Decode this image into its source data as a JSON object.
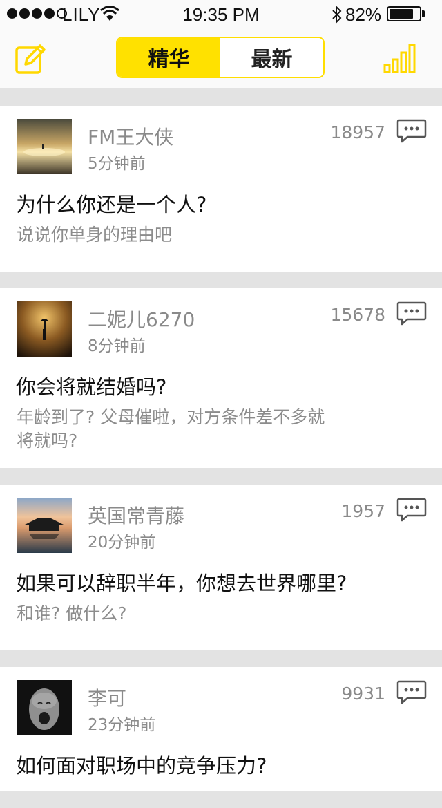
{
  "status_bar": {
    "carrier": "LILY",
    "time": "19:35 PM",
    "battery": "82%"
  },
  "nav": {
    "tabs": [
      {
        "label": "精华",
        "active": true
      },
      {
        "label": "最新",
        "active": false
      }
    ],
    "accent_color": "#ffe100"
  },
  "posts": [
    {
      "username": "FM王大侠",
      "time_ago": "5分钟前",
      "count": "18957",
      "question": "为什么你还是一个人?",
      "subtitle": "说说你单身的理由吧"
    },
    {
      "username": "二妮儿6270",
      "time_ago": "8分钟前",
      "count": "15678",
      "question": "你会将就结婚吗?",
      "subtitle": "年龄到了? 父母催啦，对方条件差不多就将就吗?"
    },
    {
      "username": "英国常青藤",
      "time_ago": "20分钟前",
      "count": "1957",
      "question": "如果可以辞职半年，你想去世界哪里?",
      "subtitle": "和谁? 做什么?"
    },
    {
      "username": "李可",
      "time_ago": "23分钟前",
      "count": "9931",
      "question": "如何面对职场中的竞争压力?",
      "subtitle": ""
    }
  ],
  "icons": {
    "compose": "compose-icon",
    "stats": "bar-chart-icon",
    "comment": "comment-bubble-icon"
  }
}
